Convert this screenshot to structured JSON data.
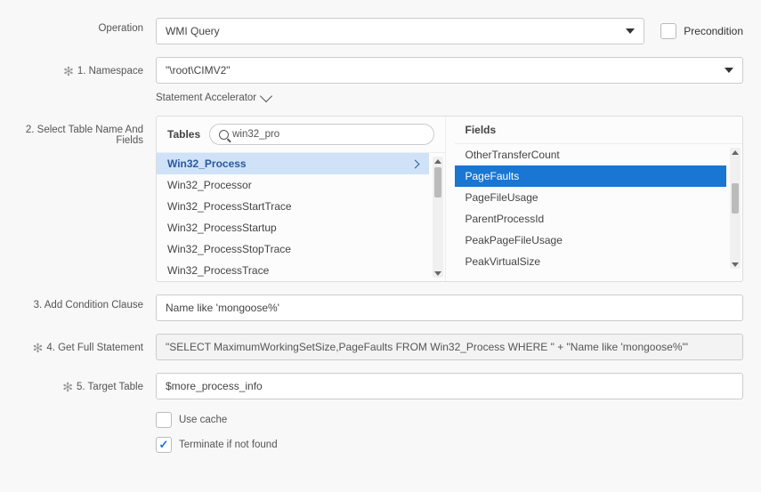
{
  "operation": {
    "label": "Operation",
    "value": "WMI Query",
    "precondition_label": "Precondition"
  },
  "namespace": {
    "label": "1. Namespace",
    "value": "\"\\root\\CIMV2\"",
    "accelerator": "Statement Accelerator"
  },
  "tables_fields": {
    "label": "2. Select Table Name And Fields",
    "tables_header": "Tables",
    "fields_header": "Fields",
    "search_value": "win32_pro",
    "tables": [
      "Win32_Process",
      "Win32_Processor",
      "Win32_ProcessStartTrace",
      "Win32_ProcessStartup",
      "Win32_ProcessStopTrace",
      "Win32_ProcessTrace"
    ],
    "fields": [
      "OtherTransferCount",
      "PageFaults",
      "PageFileUsage",
      "ParentProcessId",
      "PeakPageFileUsage",
      "PeakVirtualSize"
    ]
  },
  "condition": {
    "label": "3. Add Condition Clause",
    "value": "Name like 'mongoose%'"
  },
  "full_stmt": {
    "label": "4. Get Full Statement",
    "value": "\"SELECT MaximumWorkingSetSize,PageFaults FROM Win32_Process WHERE \" + \"Name like 'mongoose%'\""
  },
  "target": {
    "label": "5. Target Table",
    "value": "$more_process_info"
  },
  "options": {
    "use_cache": "Use cache",
    "terminate": "Terminate if not found"
  }
}
